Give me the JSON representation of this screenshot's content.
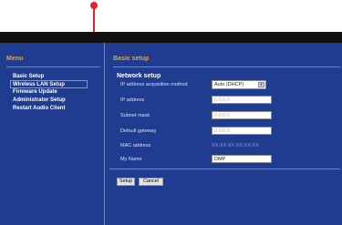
{
  "menu": {
    "title": "Menu",
    "items": [
      {
        "label": "Basic Setup"
      },
      {
        "label": "Wireless LAN Setup"
      },
      {
        "label": "Firmware Update"
      },
      {
        "label": "Administrator Setup"
      },
      {
        "label": "Restart Audio Client"
      }
    ]
  },
  "main": {
    "title": "Basic setup",
    "section": "Network setup",
    "fields": {
      "ip_method": {
        "label": "IP address acquisition method",
        "value": "Auto (DHCP)",
        "arrow_icon": "chevron-down-icon"
      },
      "ip_address": {
        "label": "IP address",
        "value": "0.0.0.0"
      },
      "subnet_mask": {
        "label": "Subnet mask",
        "value": "0.0.0.0"
      },
      "default_gateway": {
        "label": "Default gateway",
        "value": "0.0.0.0"
      },
      "mac_address": {
        "label": "MAC address",
        "value": "XX:XX:XX:XX:XX:XX"
      },
      "my_name": {
        "label": "My Name",
        "value": "DMP"
      }
    },
    "buttons": {
      "setup": "Setup",
      "cancel": "Cancel"
    }
  },
  "colors": {
    "background": "#1f3c91",
    "heading_accent": "#f3a320",
    "callout": "#e8202a",
    "topbar": "#111111"
  }
}
